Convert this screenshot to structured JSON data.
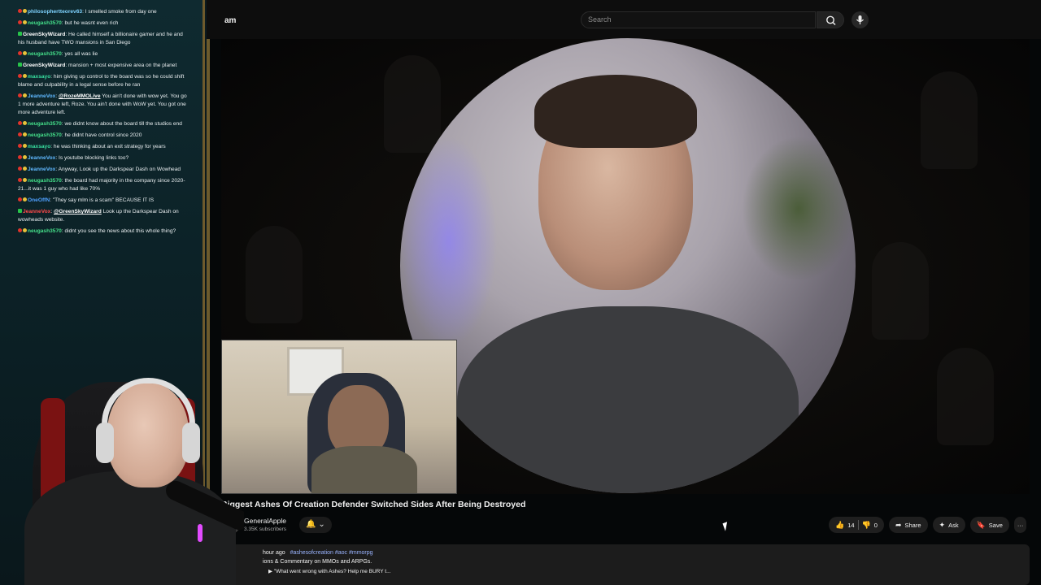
{
  "chat": {
    "messages": [
      {
        "badges": [
          "red",
          "yel"
        ],
        "user": "philosophertteorev63",
        "user_color": "#7fd3ff",
        "text": "I smelled smoke from day one"
      },
      {
        "badges": [
          "red",
          "yel"
        ],
        "user": "neugash3570",
        "user_color": "#45e08a",
        "text": "but he wasnt even rich"
      },
      {
        "badges": [
          "grn"
        ],
        "user": "GreenSkyWizard",
        "user_color": "#ffffff",
        "text": "He called himself a billionaire gamer and he and his husband have TWO mansions in San Diego"
      },
      {
        "badges": [
          "red",
          "yel"
        ],
        "user": "neugash3570",
        "user_color": "#45e08a",
        "text": "yes all was lie"
      },
      {
        "badges": [
          "grn"
        ],
        "user": "GreenSkyWizard",
        "user_color": "#ffffff",
        "text": "mansion + most expensive area on the planet"
      },
      {
        "badges": [
          "red",
          "yel"
        ],
        "user": "maxsayo",
        "user_color": "#38e0a0",
        "text": "him giving up control to the board was so he could shift blame and culpability in a legal sense before he ran"
      },
      {
        "badges": [
          "red",
          "yel"
        ],
        "user": "JeanneVox",
        "user_color": "#5fb8ff",
        "mention": "@RozeMMOLive",
        "text": "You ain't done with wow yet. You go 1 more adventure left, Roze. You ain't done with WoW yet. You got one more adventure left."
      },
      {
        "badges": [
          "red",
          "yel"
        ],
        "user": "neugash3570",
        "user_color": "#45e08a",
        "text": "we didnt know about the board till the studios end"
      },
      {
        "badges": [
          "red",
          "yel"
        ],
        "user": "neugash3570",
        "user_color": "#45e08a",
        "text": "he didnt have control since 2020"
      },
      {
        "badges": [
          "red",
          "yel"
        ],
        "user": "maxsayo",
        "user_color": "#38e0a0",
        "text": "he was thinking about an exit strategy for years"
      },
      {
        "badges": [
          "red",
          "yel"
        ],
        "user": "JeanneVox",
        "user_color": "#5fb8ff",
        "text": "Is youtube blocking links too?"
      },
      {
        "badges": [
          "red",
          "yel"
        ],
        "user": "JeanneVox",
        "user_color": "#5fb8ff",
        "text": "Anyway, Look up the Darkspear Dash on Wowhead"
      },
      {
        "badges": [
          "red",
          "yel"
        ],
        "user": "neugash3570",
        "user_color": "#45e08a",
        "text": "the board had majority in the company since 2020-21...it was 1 guy who had like 70%"
      },
      {
        "badges": [
          "red",
          "yel"
        ],
        "user": "OneOffN",
        "user_color": "#4fa0ff",
        "text": "\"They say mlm is a scam\" BECAUSE IT IS"
      },
      {
        "badges": [
          "grn"
        ],
        "user": "JeanneVox",
        "user_color": "#ff4a4a",
        "mention": "@GreenSkyWizard",
        "text": "Look up the Darkspear Dash on wowheads website."
      },
      {
        "badges": [
          "red",
          "yel"
        ],
        "user": "neugash3570",
        "user_color": "#45e08a",
        "text": "didnt you see the news about this whole thing?"
      }
    ]
  },
  "youtube": {
    "logo_fragment": "am",
    "search_placeholder": "Search",
    "search_icon": "search-icon",
    "mic_icon": "mic-icon",
    "video_title": "Biggest Ashes Of Creation Defender Switched Sides After Being Destroyed",
    "channel_name": "GeneralApple",
    "subscribers": "3.35K subscribers",
    "bell_glyph": "🔔",
    "chevron_glyph": "⌄",
    "likes": "14",
    "dislikes": "0",
    "share_label": "Share",
    "ask_label": "Ask",
    "save_label": "Save",
    "more_glyph": "···",
    "desc": {
      "time": "hour ago",
      "tags": "#ashesofcreation #aoc #mmorpg",
      "line2": "ions & Commentary on MMOs and ARPGs.",
      "line3": "▶ \"What went wrong with Ashes? Help me BURY t..."
    }
  },
  "colors": {
    "frame_gold": "#6b5a2d",
    "chat_bg": "#0f2a30",
    "yt_bg": "#0d0d0d"
  }
}
